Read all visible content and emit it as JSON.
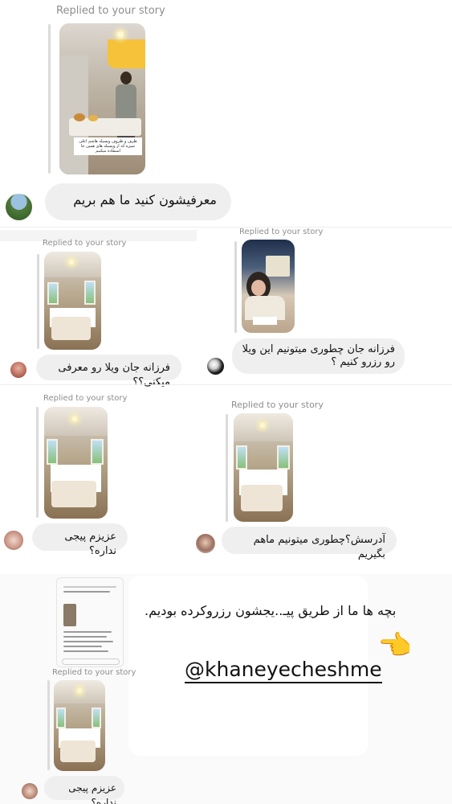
{
  "replied_label": "Replied to your story",
  "messages": [
    {
      "text": "معرفیشون کنید ما هم بریم"
    },
    {
      "text": "فرزانه جان ویلا رو معرفی میکنی؟؟"
    },
    {
      "text": "فرزانه جان چطوری میتونیم این ویلا رو رزرو کنیم ؟"
    },
    {
      "text": "عزیزم پیجی نداره؟"
    },
    {
      "text": "آدرسش؟چطوری میتونیم ماهم بگیریم"
    },
    {
      "text": "عزیزم پیجی نداره؟"
    }
  ],
  "story_captions": {
    "first": "ظرف و ظروف ویسیله هاشم اعلی تمیزه که از ویسیله های همین جا استفاده میکنیم"
  },
  "annotation": {
    "note": "بچه ها ما از طریق پیـ..یجشون رزروکرده بودیم.",
    "handle": "@khaneyecheshme",
    "emoji": "👉"
  },
  "colors": {
    "bubble": "#efefef",
    "meta": "#8e8e8e",
    "rule": "#dbdbdb"
  }
}
